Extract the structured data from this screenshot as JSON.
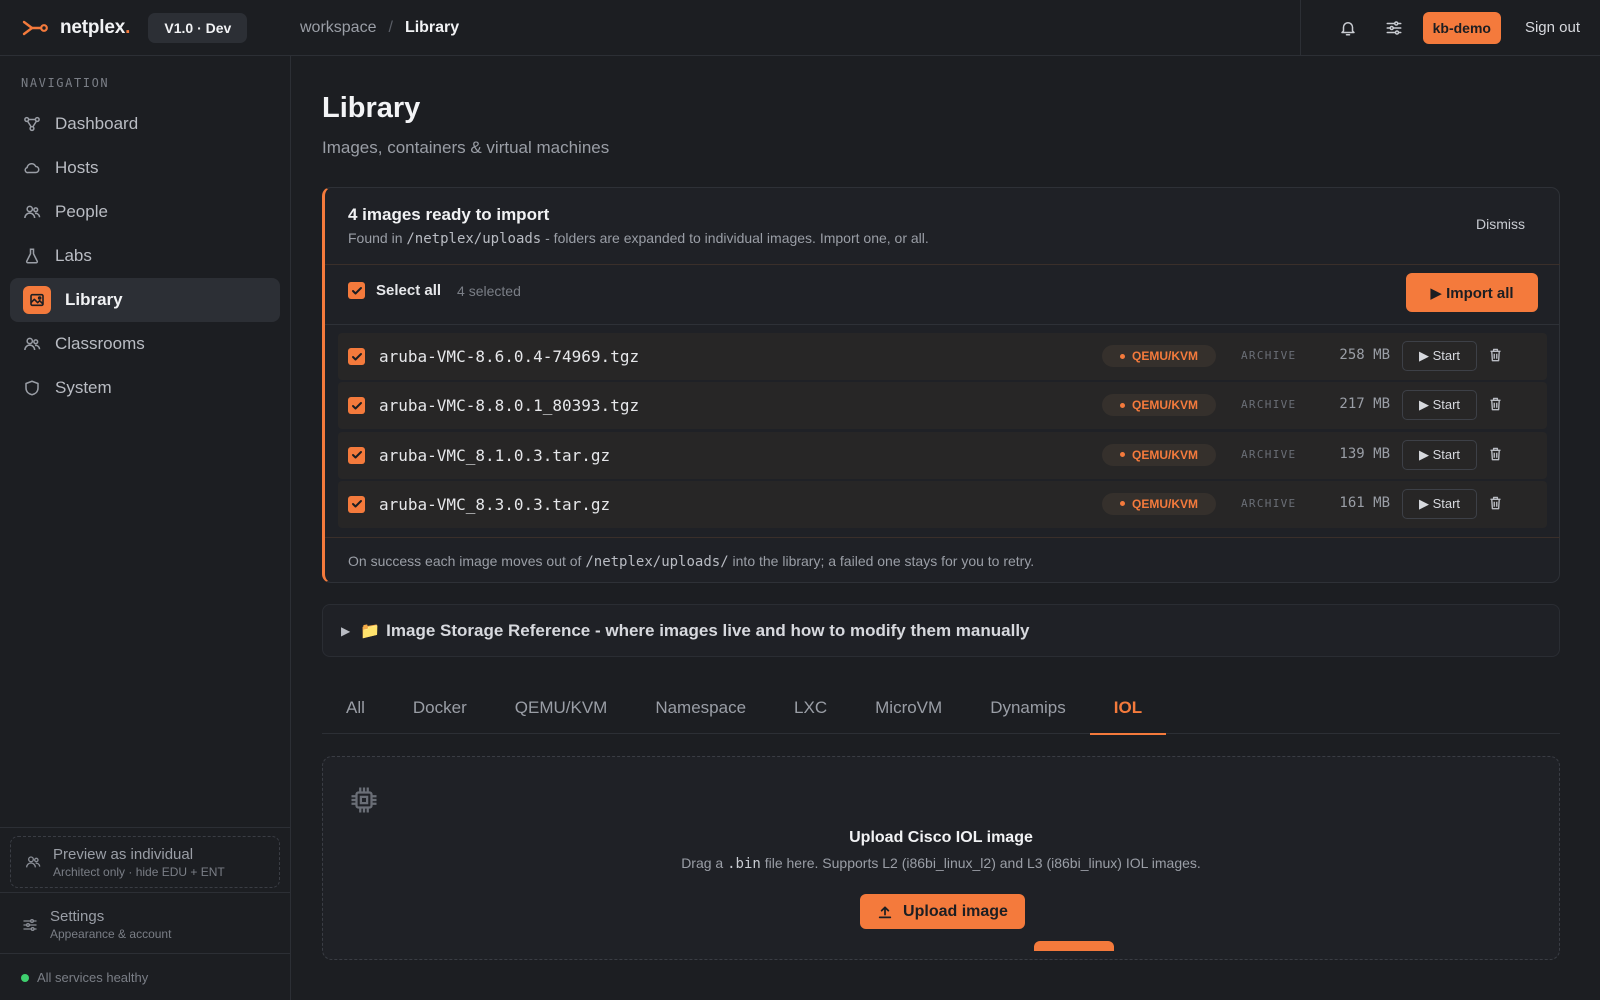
{
  "brand": {
    "name": "netplex",
    "dot": ".",
    "version": "V1.0 · Dev"
  },
  "breadcrumb": {
    "root": "workspace",
    "sep": "/",
    "current": "Library"
  },
  "topbar": {
    "user": "kb-demo",
    "sign_out": "Sign out"
  },
  "sidebar": {
    "heading": "NAVIGATION",
    "items": [
      {
        "label": "Dashboard",
        "icon": "graph-icon"
      },
      {
        "label": "Hosts",
        "icon": "cloud-icon"
      },
      {
        "label": "People",
        "icon": "people-icon"
      },
      {
        "label": "Labs",
        "icon": "flask-icon"
      },
      {
        "label": "Library",
        "icon": "image-icon",
        "active": true
      },
      {
        "label": "Classrooms",
        "icon": "people-icon"
      },
      {
        "label": "System",
        "icon": "shield-icon"
      }
    ],
    "preview": {
      "title": "Preview as individual",
      "sub": "Architect only · hide EDU + ENT"
    },
    "settings": {
      "title": "Settings",
      "sub": "Appearance & account"
    },
    "health": "All services healthy"
  },
  "page": {
    "title": "Library",
    "subtitle": "Images, containers & virtual machines"
  },
  "import_card": {
    "title": "4 images ready to import",
    "desc_prefix": "Found in",
    "desc_path": "/netplex/uploads",
    "desc_suffix": "- folders are expanded to individual images. Import one, or all.",
    "dismiss": "Dismiss",
    "select_all": "Select all",
    "selected_count": "4 selected",
    "import_all": "▶ Import all",
    "files": [
      {
        "name": "aruba-VMC-8.6.0.4-74969.tgz",
        "tag": "QEMU/KVM",
        "kind": "ARCHIVE",
        "size": "258 MB",
        "start": "▶ Start"
      },
      {
        "name": "aruba-VMC-8.8.0.1_80393.tgz",
        "tag": "QEMU/KVM",
        "kind": "ARCHIVE",
        "size": "217 MB",
        "start": "▶ Start"
      },
      {
        "name": "aruba-VMC_8.1.0.3.tar.gz",
        "tag": "QEMU/KVM",
        "kind": "ARCHIVE",
        "size": "139 MB",
        "start": "▶ Start"
      },
      {
        "name": "aruba-VMC_8.3.0.3.tar.gz",
        "tag": "QEMU/KVM",
        "kind": "ARCHIVE",
        "size": "161 MB",
        "start": "▶ Start"
      }
    ],
    "foot_prefix": "On success each image moves out of",
    "foot_path": "/netplex/uploads/",
    "foot_suffix": "into the library; a failed one stays for you to retry."
  },
  "storage_ref": {
    "caret": "▶",
    "folder": "📁",
    "text": "Image Storage Reference - where images live and how to modify them manually"
  },
  "tabs": [
    {
      "label": "All"
    },
    {
      "label": "Docker"
    },
    {
      "label": "QEMU/KVM"
    },
    {
      "label": "Namespace"
    },
    {
      "label": "LXC"
    },
    {
      "label": "MicroVM"
    },
    {
      "label": "Dynamips"
    },
    {
      "label": "IOL",
      "active": true
    }
  ],
  "upload": {
    "title": "Upload Cisco IOL image",
    "desc_prefix": "Drag a",
    "desc_ext": ".bin",
    "desc_suffix": "file here. Supports L2 (i86bi_linux_l2) and L3 (i86bi_linux) IOL images.",
    "button": "Upload image"
  },
  "colors": {
    "accent": "#f47a3c",
    "background": "#1c1e22",
    "healthy": "#3ecf6e"
  }
}
